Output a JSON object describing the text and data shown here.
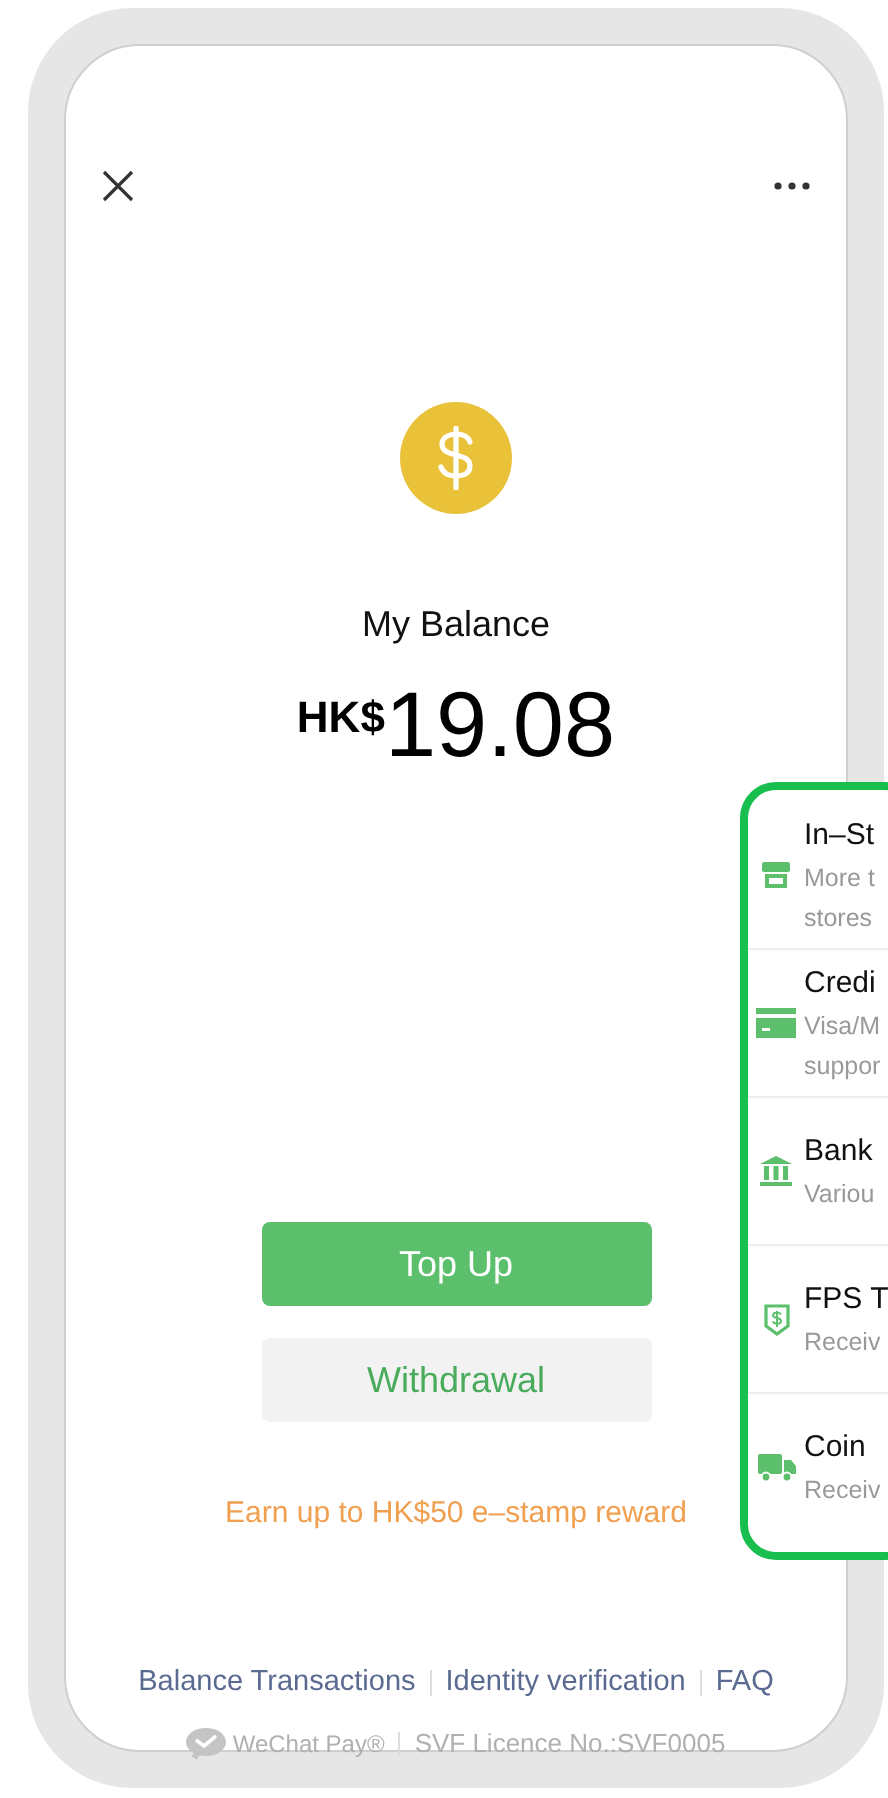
{
  "balance": {
    "label": "My Balance",
    "currency": "HK$",
    "amount": "19.08"
  },
  "buttons": [
    {
      "label": "Top Up",
      "kind": "primary"
    },
    {
      "label": "Withdrawal",
      "kind": "secondary"
    }
  ],
  "promo": "Earn up to HK$50 e–stamp reward",
  "links": [
    "Balance Transactions",
    "Identity verification",
    "FAQ"
  ],
  "footer": {
    "brand": "WeChat Pay®",
    "licence": "SVF Licence No.:SVF0005"
  },
  "methods": [
    {
      "kind": "store",
      "title": "In–St",
      "subtitle_lines": [
        "More t",
        "stores"
      ]
    },
    {
      "kind": "card",
      "title": "Credi",
      "subtitle_lines": [
        "Visa/M",
        "suppor"
      ]
    },
    {
      "kind": "bank",
      "title": "Bank",
      "subtitle_lines": [
        "Variou"
      ]
    },
    {
      "kind": "fps",
      "title": "FPS T",
      "subtitle_lines": [
        "Receiv"
      ]
    },
    {
      "kind": "truck",
      "title": "Coin",
      "subtitle_lines": [
        "Receiv"
      ]
    }
  ]
}
